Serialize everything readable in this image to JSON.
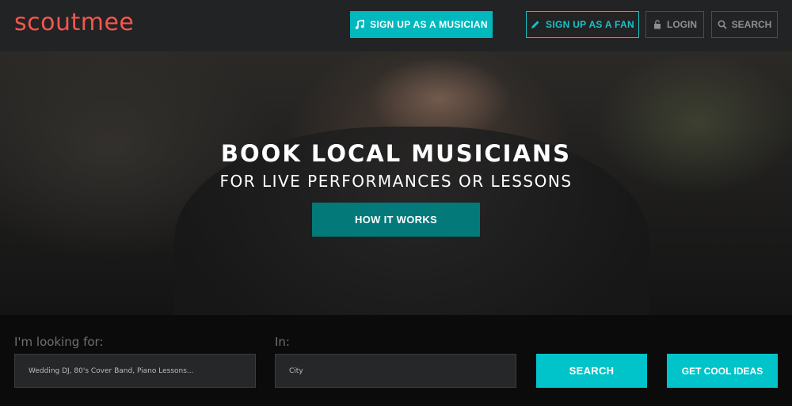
{
  "header": {
    "logo": "scoutmee",
    "signup_musician": "SIGN UP AS A MUSICIAN",
    "signup_fan": "SIGN UP AS A FAN",
    "login": "LOGIN",
    "search": "SEARCH"
  },
  "hero": {
    "title": "BOOK LOCAL MUSICIANS",
    "subtitle": "FOR LIVE PERFORMANCES OR LESSONS",
    "cta": "HOW IT WORKS"
  },
  "search_form": {
    "looking_for_label": "I'm looking for:",
    "looking_for_placeholder": "Wedding DJ, 80's Cover Band, Piano Lessons...",
    "in_label": "In:",
    "city_placeholder": "City",
    "search_button": "SEARCH",
    "ideas_button": "GET COOL IDEAS"
  },
  "colors": {
    "brand": "#f2574f",
    "accent": "#00c4c9",
    "accent_dark": "#03797a",
    "header_bg": "#222324"
  },
  "icons": [
    "music-note-icon",
    "pencil-icon",
    "lock-icon",
    "search-icon"
  ]
}
